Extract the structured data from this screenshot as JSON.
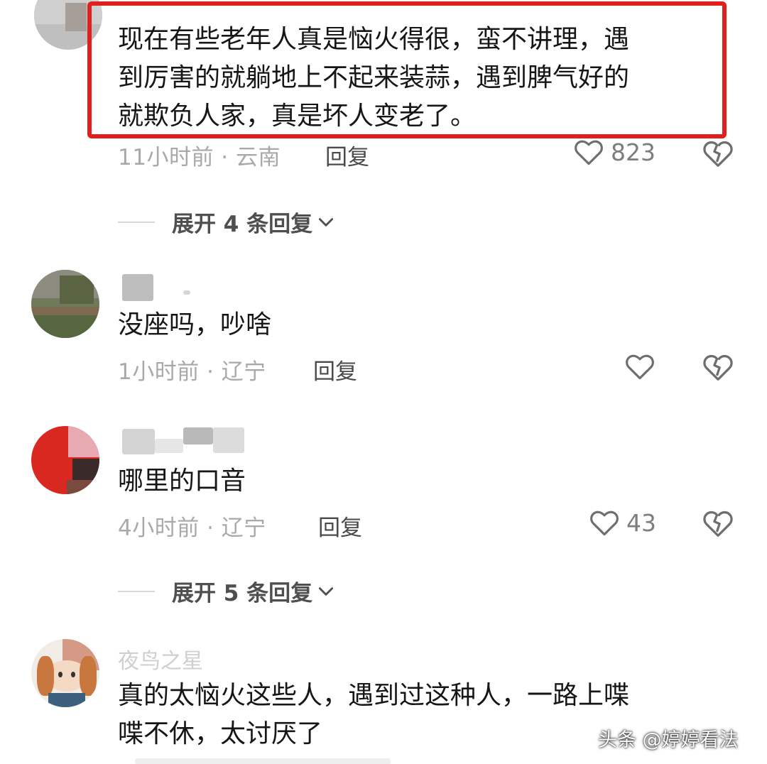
{
  "comments": [
    {
      "text_lines": [
        "现在有些老年人真是恼火得很，蛮不讲理，遇",
        "到厉害的就躺地上不起来装蒜，遇到脾气好的",
        "就欺负人家，真是坏人变老了。"
      ],
      "meta": "11小时前 · 云南",
      "reply": "回复",
      "likes": "823",
      "highlighted": true,
      "highlight_color": "#e0201c"
    },
    {
      "text_lines": [
        "没座吗，吵啥"
      ],
      "meta": "1小时前 · 辽宁",
      "reply": "回复",
      "likes": ""
    },
    {
      "text_lines": [
        "哪里的口音"
      ],
      "meta": "4小时前 · 辽宁",
      "reply": "回复",
      "likes": "43"
    },
    {
      "username": "夜鸟之星",
      "text_lines": [
        "真的太恼火这些人，遇到过这种人，一路上喋",
        "喋不休，太讨厌了"
      ]
    }
  ],
  "expand_replies": [
    "展开 4 条回复",
    "展开 5 条回复"
  ],
  "watermark": "头条 @婷婷看法",
  "icons": {
    "like": "heart-outline-icon",
    "dislike": "broken-heart-icon",
    "expand": "chevron-down-icon"
  },
  "colors": {
    "text": "#161616",
    "meta": "#a9a9a9",
    "highlight": "#e0201c"
  }
}
